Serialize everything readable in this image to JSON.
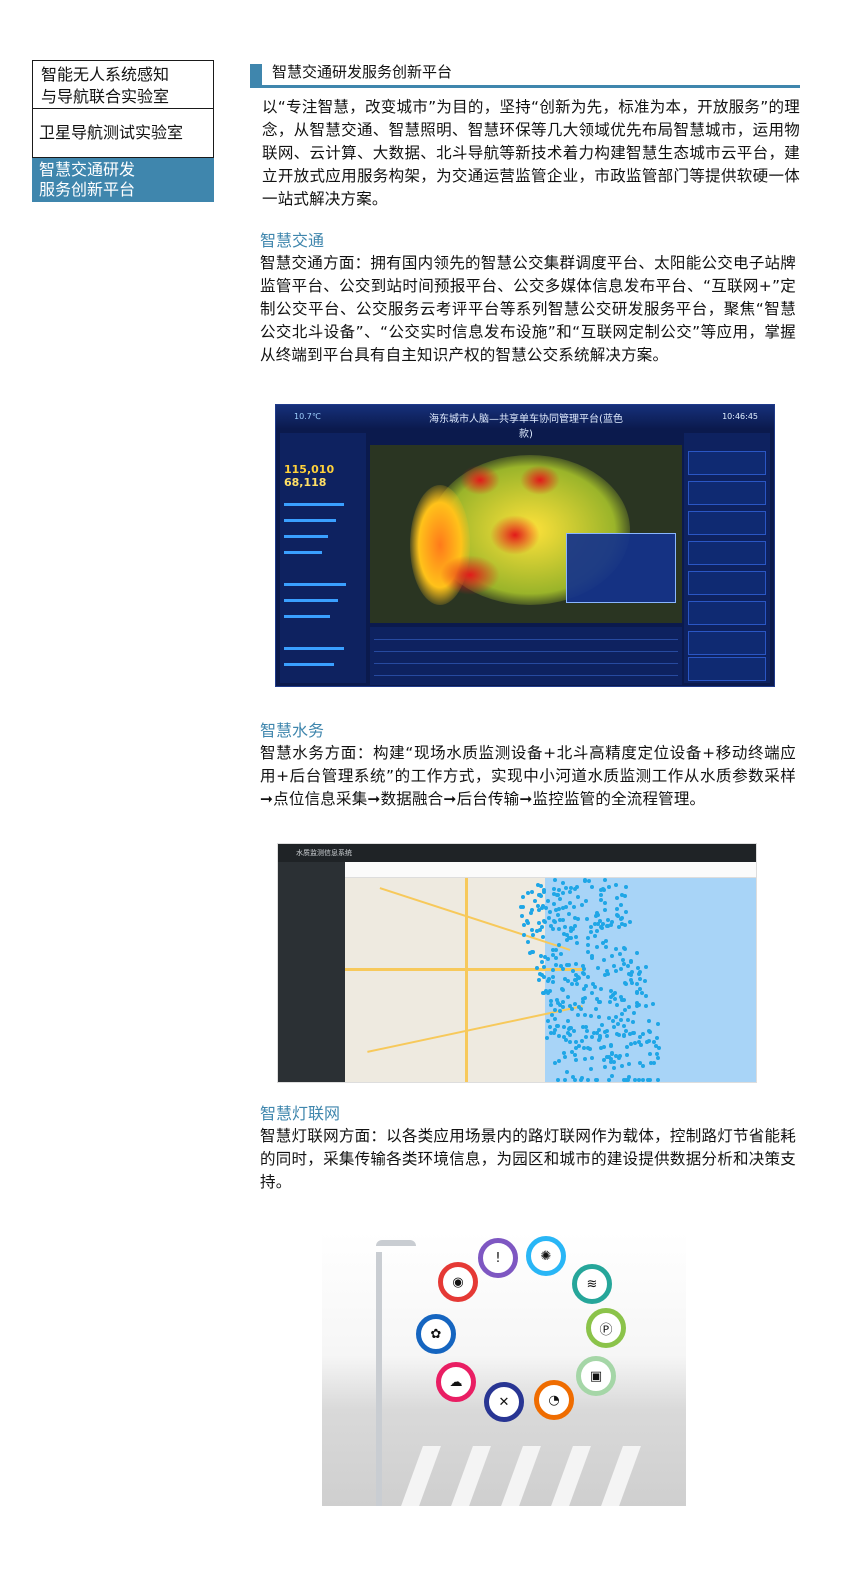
{
  "sidebar": {
    "items": [
      {
        "label_line1": "智能无人系统感知",
        "label_line2": "与导航联合实验室"
      },
      {
        "label": "卫星导航测试实验室"
      },
      {
        "label_line1": "智慧交通研发",
        "label_line2": "服务创新平台"
      }
    ]
  },
  "header": {
    "title": "智慧交通研发服务创新平台"
  },
  "intro": "以“专注智慧，改变城市”为目的，坚持“创新为先，标准为本，开放服务”的理念，从智慧交通、智慧照明、智慧环保等几大领域优先布局智慧城市，运用物联网、云计算、大数据、北斗导航等新技术着力构建智慧生态城市云平台，建立开放式应用服务构架，为交通运营监管企业，市政监管部门等提供软硬一体一站式解决方案。",
  "sections": [
    {
      "title": "智慧交通",
      "body": "智慧交通方面：拥有国内领先的智慧公交集群调度平台、太阳能公交电子站牌监管平台、公交到站时间预报平台、公交多媒体信息发布平台、“互联网+”定制公交平台、公交服务云考评平台等系列智慧公交研发服务平台，聚焦“智慧公交北斗设备”、“公交实时信息发布设施”和“互联网定制公交”等应用，掌握从终端到平台具有自主知识产权的智慧公交系统解决方案。"
    },
    {
      "title": "智慧水务",
      "body": "智慧水务方面：构建“现场水质监测设备+北斗高精度定位设备+移动终端应用+后台管理系统”的工作方式，实现中小河道水质监测工作从水质参数采样➞点位信息采集➞数据融合➞后台传输➞监控监管的全流程管理。"
    },
    {
      "title": "智慧灯联网",
      "body": "智慧灯联网方面：以各类应用场景内的路灯联网作为载体，控制路灯节省能耗的同时，采集传输各类环境信息，为园区和城市的建设提供数据分析和决策支持。"
    }
  ],
  "dashboard": {
    "title": "海东城市人脑—共享单车协同管理平台(蓝色款)",
    "top_left": "10.7℃",
    "time": "10:46:45",
    "count1": "115,010",
    "count2": "68,118"
  },
  "water_app": {
    "title": "水质监测信息系统"
  },
  "colors": {
    "accent": "#3f86ad",
    "title_blue": "#3f86ad"
  }
}
